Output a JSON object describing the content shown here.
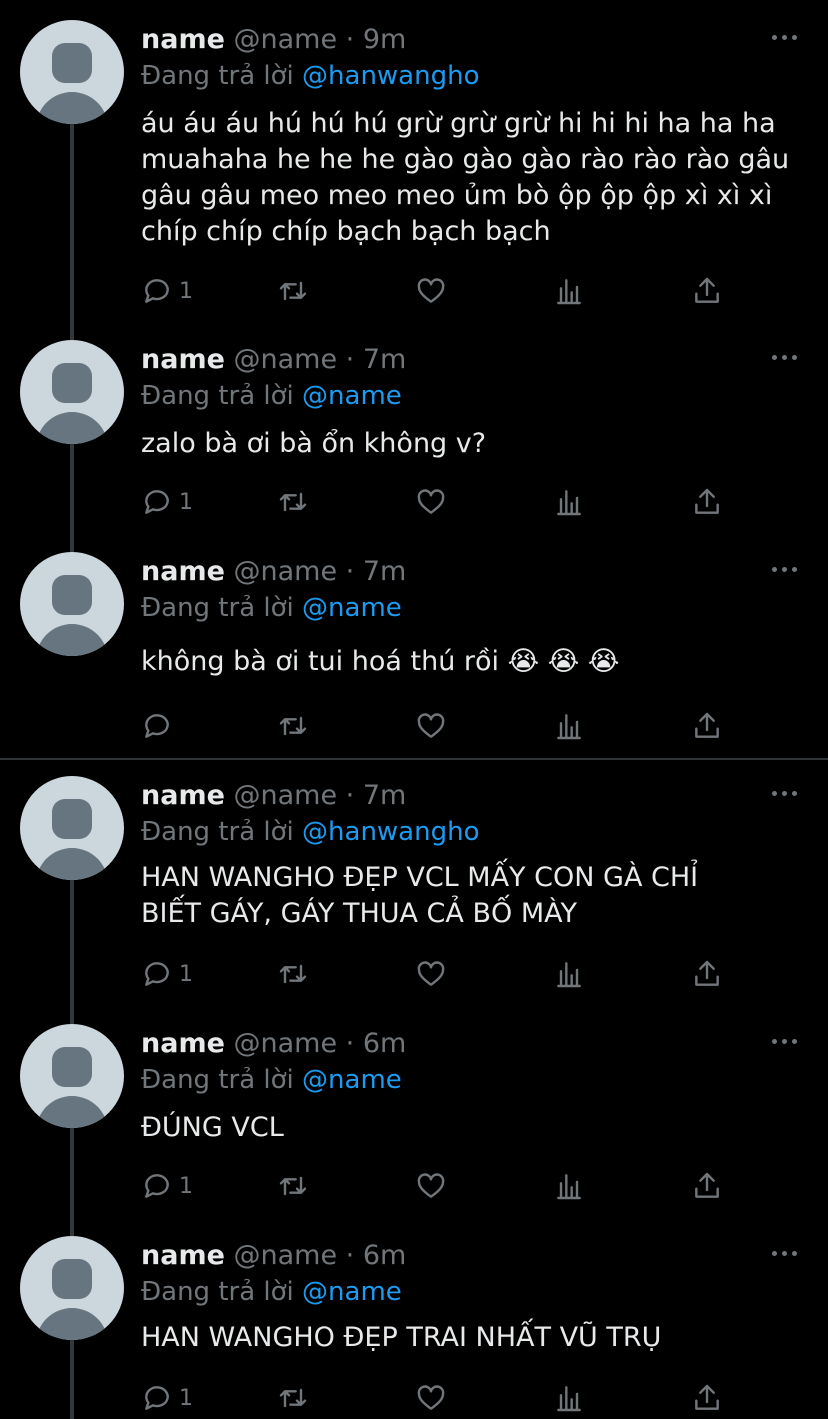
{
  "colors": {
    "background": "#000000",
    "text": "#e7e9ea",
    "muted": "#71767b",
    "link": "#1d9bf0",
    "avatar_bg": "#ccd6dd",
    "avatar_fg": "#66757f"
  },
  "tweets": [
    {
      "name": "name",
      "handle": "@name",
      "time": "· 9m",
      "reply_label": "Đang trả lời",
      "reply_to": "@hanwangho",
      "text": "áu áu áu hú hú hú grừ grừ grừ hi hi hi ha ha ha\nmuahaha he he he gào gào gào rào rào rào gâu\ngâu gâu meo meo meo ủm bò ộp ộp ộp xì xì xì\nchíp chíp chíp bạch bạch bạch",
      "reply_count": "1"
    },
    {
      "name": "name",
      "handle": "@name",
      "time": "· 7m",
      "reply_label": "Đang trả lời",
      "reply_to": "@name",
      "text": "zalo bà ơi bà ổn không v?",
      "reply_count": "1"
    },
    {
      "name": "name",
      "handle": "@name",
      "time": "· 7m",
      "reply_label": "Đang trả lời",
      "reply_to": "@name",
      "text": "không bà ơi tui hoá thú rồi 😭 😭 😭",
      "reply_count": ""
    },
    {
      "name": "name",
      "handle": "@name",
      "time": "· 7m",
      "reply_label": "Đang trả lời",
      "reply_to": "@hanwangho",
      "text": "HAN WANGHO ĐẸP VCL MẤY CON GÀ CHỈ\nBIẾT GÁY, GÁY THUA CẢ BỐ MÀY",
      "reply_count": "1"
    },
    {
      "name": "name",
      "handle": "@name",
      "time": "· 6m",
      "reply_label": "Đang trả lời",
      "reply_to": "@name",
      "text": "ĐÚNG VCL",
      "reply_count": "1"
    },
    {
      "name": "name",
      "handle": "@name",
      "time": "· 6m",
      "reply_label": "Đang trả lời",
      "reply_to": "@name",
      "text": "HAN WANGHO ĐẸP TRAI NHẤT VŨ TRỤ",
      "reply_count": "1"
    }
  ],
  "icons": [
    "reply-icon",
    "retweet-icon",
    "like-icon",
    "analytics-icon",
    "share-icon",
    "more-icon",
    "avatar-icon"
  ]
}
